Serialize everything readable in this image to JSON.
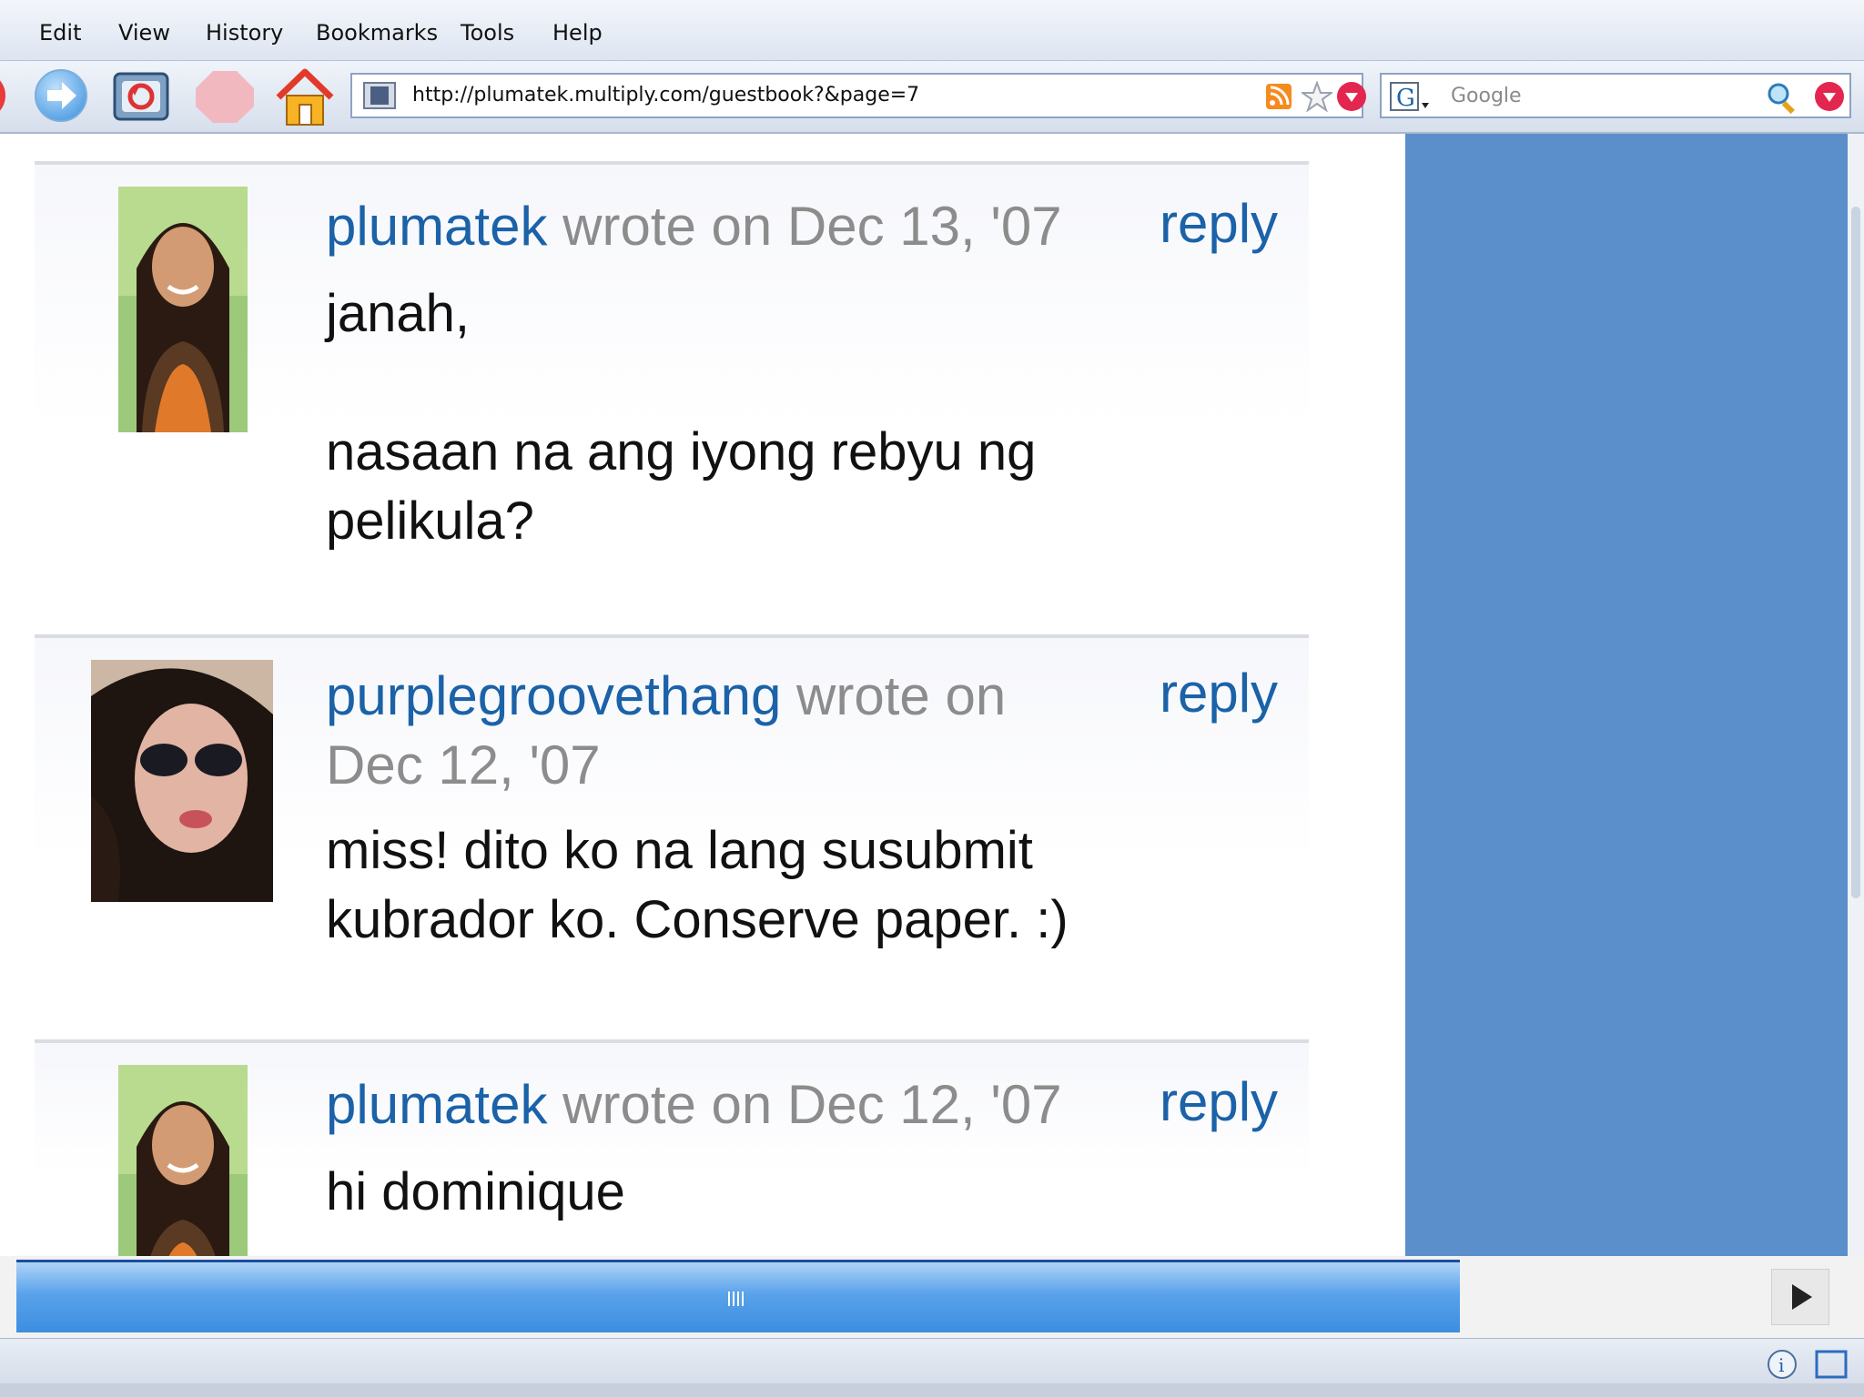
{
  "menu": {
    "items": [
      {
        "label": "Edit"
      },
      {
        "label": "View"
      },
      {
        "label": "History"
      },
      {
        "label": "Bookmarks"
      },
      {
        "label": "Tools"
      },
      {
        "label": "Help"
      }
    ]
  },
  "navbar": {
    "url": "http://plumatek.multiply.com/guestbook?&page=7",
    "search_placeholder": "Google",
    "icons": [
      "back-icon",
      "forward-icon",
      "reload-icon",
      "stop-icon",
      "home-icon",
      "site-identity-icon",
      "rss-icon",
      "bookmark-star-icon",
      "dropdown-icon",
      "google-icon",
      "search-icon",
      "dropdown-icon"
    ]
  },
  "guestbook": {
    "entries": [
      {
        "author": "plumatek",
        "meta": " wrote on Dec 13, '07",
        "reply": "reply",
        "body": "janah,\n\nnasaan na ang iyong rebyu ng pelikula?"
      },
      {
        "author": "purplegroovethang",
        "meta": " wrote on Dec 12, '07",
        "reply": "reply",
        "body": "miss! dito ko na lang susubmit kubrador ko. Conserve paper. :)"
      },
      {
        "author": "plumatek",
        "meta": " wrote on Dec 12, '07",
        "reply": "reply",
        "body": "hi dominique"
      }
    ]
  },
  "colors": {
    "link": "#1b62a8",
    "meta": "#8c8c8c",
    "side_panel": "#5b8fcc",
    "scroll_thumb": "#3d8ee0"
  }
}
